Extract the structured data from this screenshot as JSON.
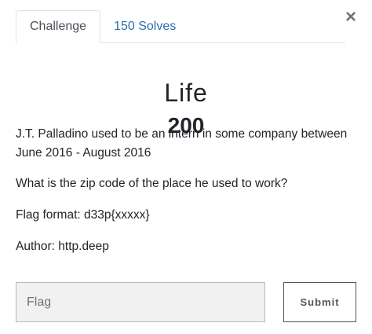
{
  "modal": {
    "close_symbol": "×"
  },
  "tabs": [
    {
      "label": "Challenge",
      "active": true
    },
    {
      "label": "150 Solves",
      "active": false
    }
  ],
  "challenge": {
    "name": "Life",
    "value": "200",
    "description": [
      "J.T. Palladino used to be an intern in some company between June 2016 - August 2016",
      "What is the zip code of the place he used to work?",
      "Flag format: d33p{xxxxx}",
      "Author: http.deep"
    ]
  },
  "form": {
    "flag_placeholder": "Flag",
    "flag_value": "",
    "submit_label": "Submit"
  },
  "colors": {
    "link": "#2c6ead",
    "input_bg": "#f1f1f1",
    "button_border": "#555555"
  }
}
